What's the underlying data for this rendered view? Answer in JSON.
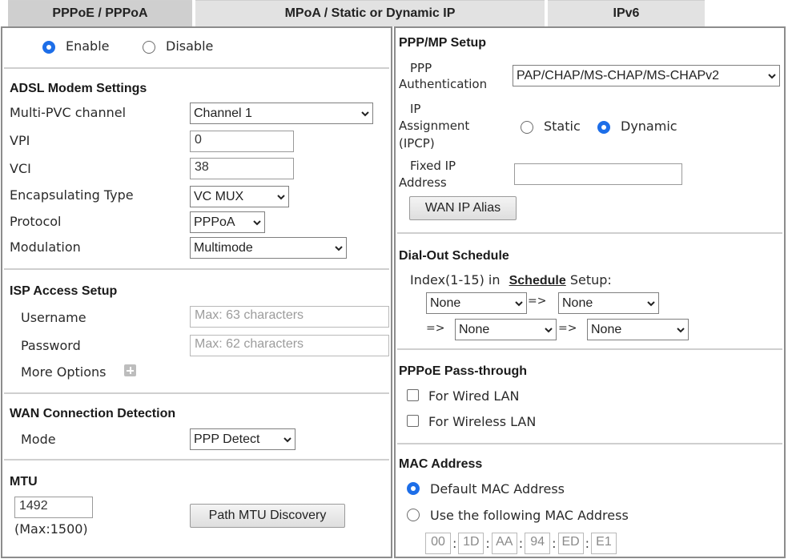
{
  "tabs": [
    {
      "label": "PPPoE / PPPoA"
    },
    {
      "label": "MPoA / Static or Dynamic IP"
    },
    {
      "label": "IPv6"
    }
  ],
  "left": {
    "enable_label": "Enable",
    "disable_label": "Disable",
    "enable_selected": true,
    "adsl": {
      "heading": "ADSL Modem Settings",
      "multi_pvc_label": "Multi-PVC channel",
      "multi_pvc_value": "Channel 1",
      "vpi_label": "VPI",
      "vpi_value": "0",
      "vci_label": "VCI",
      "vci_value": "38",
      "encap_label": "Encapsulating Type",
      "encap_value": "VC MUX",
      "protocol_label": "Protocol",
      "protocol_value": "PPPoA",
      "modulation_label": "Modulation",
      "modulation_value": "Multimode"
    },
    "isp": {
      "heading": "ISP Access Setup",
      "username_label": "Username",
      "username_placeholder": "Max: 63 characters",
      "password_label": "Password",
      "password_placeholder": "Max: 62 characters",
      "more_options_label": "More Options"
    },
    "wan_detect": {
      "heading": "WAN Connection Detection",
      "mode_label": "Mode",
      "mode_value": "PPP Detect"
    },
    "mtu": {
      "heading": "MTU",
      "value": "1492",
      "max_note": "(Max:1500)",
      "path_button": "Path MTU Discovery"
    }
  },
  "right": {
    "ppp": {
      "heading": "PPP/MP Setup",
      "auth_label_1": "PPP",
      "auth_label_2": "Authentication",
      "auth_value": "PAP/CHAP/MS-CHAP/MS-CHAPv2",
      "ip_label_1": "IP",
      "ip_label_2": "Assignment",
      "ip_label_3": "(IPCP)",
      "static_label": "Static",
      "dynamic_label": "Dynamic",
      "dynamic_selected": true,
      "fixed_label_1": "Fixed IP",
      "fixed_label_2": "Address",
      "fixed_value": "",
      "alias_button": "WAN IP Alias"
    },
    "dialout": {
      "heading": "Dial-Out Schedule",
      "index_prefix": "Index(1-15) in",
      "schedule_link": "Schedule",
      "index_suffix": "Setup:",
      "arrow": "=>",
      "slots": [
        "None",
        "None",
        "None",
        "None"
      ]
    },
    "passthrough": {
      "heading": "PPPoE Pass-through",
      "wired_label": "For Wired LAN",
      "wireless_label": "For Wireless LAN"
    },
    "mac": {
      "heading": "MAC Address",
      "default_label": "Default MAC Address",
      "custom_label": "Use the following MAC Address",
      "octets": [
        "00",
        "1D",
        "AA",
        "94",
        "ED",
        "E1"
      ]
    }
  }
}
